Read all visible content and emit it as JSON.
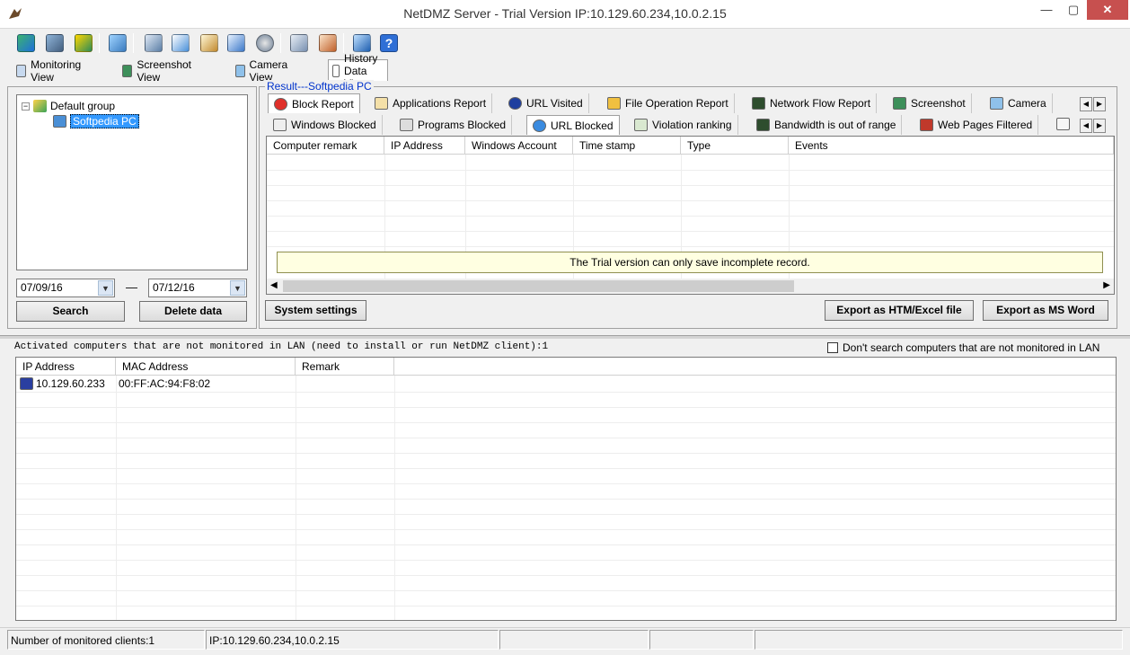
{
  "window": {
    "title": "NetDMZ Server - Trial Version IP:10.129.60.234,10.0.2.15",
    "min": "—",
    "max": "▢",
    "close": "✕"
  },
  "view_tabs": [
    "Monitoring View",
    "Screenshot View",
    "Camera View",
    "History Data View"
  ],
  "tree": {
    "group": "Default group",
    "pc": "Softpedia PC"
  },
  "dates": {
    "from": "07/09/16",
    "dash": "—",
    "to": "07/12/16"
  },
  "buttons": {
    "search": "Search",
    "delete": "Delete data",
    "settings": "System settings",
    "export_htm": "Export as HTM/Excel file",
    "export_word": "Export as MS Word"
  },
  "result": {
    "legend": "Result---Softpedia PC"
  },
  "report_tabs_row1": [
    "Block Report",
    "Applications Report",
    "URL Visited",
    "File Operation Report",
    "Network Flow Report",
    "Screenshot",
    "Camera"
  ],
  "report_tabs_row2": [
    "Windows Blocked",
    "Programs Blocked",
    "URL Blocked",
    "Violation ranking",
    "Bandwidth is out of range",
    "Web Pages Filtered"
  ],
  "grid": {
    "headers": [
      "Computer remark",
      "IP Address",
      "Windows Account",
      "Time stamp",
      "Type",
      "Events"
    ]
  },
  "notice": "The Trial version can only save incomplete record.",
  "lan": {
    "label": "Activated computers that are not monitored in LAN (need to install or run NetDMZ client):1",
    "checkbox": "Don't search computers that are not monitored in LAN",
    "headers": [
      "IP Address",
      "MAC Address",
      "Remark"
    ],
    "rows": [
      {
        "ip": "10.129.60.233",
        "mac": "00:FF:AC:94:F8:02",
        "remark": ""
      }
    ]
  },
  "status": {
    "clients": "Number of monitored clients:1",
    "ip": "IP:10.129.60.234,10.0.2.15"
  },
  "colors": {
    "accent": "#3399ff",
    "notice_bg": "#ffffe1",
    "close_btn": "#c7504f",
    "legend": "#0033cc"
  }
}
